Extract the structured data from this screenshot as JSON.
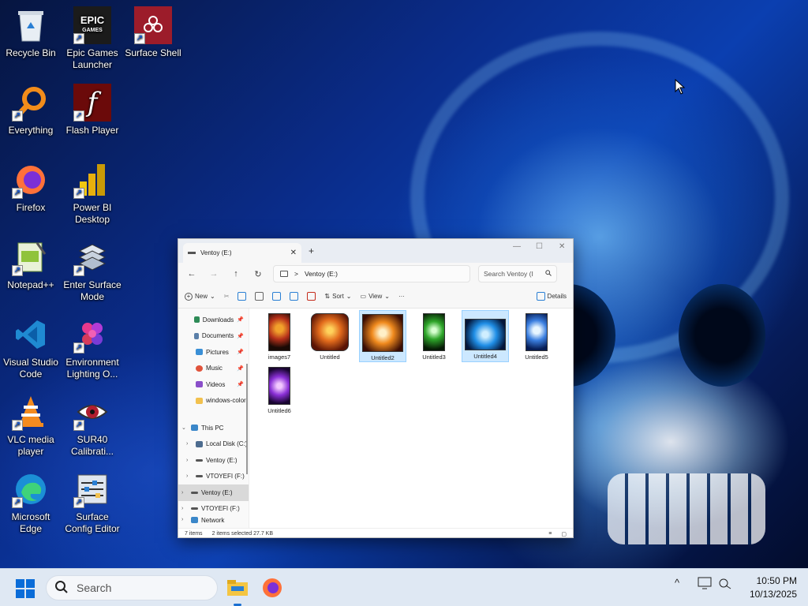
{
  "desktop": {
    "icons": [
      {
        "label": "Recycle Bin",
        "icon": "recycle-bin-icon"
      },
      {
        "label": "Epic Games Launcher",
        "icon": "epic-games-icon"
      },
      {
        "label": "Surface Shell",
        "icon": "surface-shell-icon"
      },
      {
        "label": "Everything",
        "icon": "everything-search-icon"
      },
      {
        "label": "Flash Player",
        "icon": "flash-player-icon"
      },
      {
        "label": "Firefox",
        "icon": "firefox-icon"
      },
      {
        "label": "Power BI Desktop",
        "icon": "power-bi-icon"
      },
      {
        "label": "Notepad++",
        "icon": "notepad-plus-plus-icon"
      },
      {
        "label": "Enter Surface Mode",
        "icon": "surface-mode-icon"
      },
      {
        "label": "Visual Studio Code",
        "icon": "vscode-icon"
      },
      {
        "label": "Environment Lighting O...",
        "icon": "environment-lighting-icon"
      },
      {
        "label": "VLC media player",
        "icon": "vlc-icon"
      },
      {
        "label": "SUR40 Calibrati...",
        "icon": "sur40-calibration-icon"
      },
      {
        "label": "Microsoft Edge",
        "icon": "edge-icon"
      },
      {
        "label": "Surface Config Editor",
        "icon": "surface-config-editor-icon"
      }
    ]
  },
  "explorer": {
    "tab_title": "Ventoy (E:)",
    "tab_close": "✕",
    "new_tab": "+",
    "window_controls": {
      "minimize": "—",
      "maximize": "☐",
      "close": "✕"
    },
    "nav": {
      "back": "←",
      "forward": "→",
      "up": "↑",
      "refresh": "↻"
    },
    "address": {
      "separator": ">",
      "path": "Ventoy (E:)"
    },
    "search_placeholder": "Search Ventoy (I",
    "toolbar": {
      "new": "New",
      "sort": "Sort",
      "view": "View",
      "more": "···",
      "details": "Details"
    },
    "navpane": [
      {
        "label": "Downloads",
        "pinned": true,
        "color": "#2e8b57",
        "chev": ""
      },
      {
        "label": "Documents",
        "pinned": true,
        "color": "#5a7fa8",
        "chev": ""
      },
      {
        "label": "Pictures",
        "pinned": true,
        "color": "#3a8fd6",
        "chev": ""
      },
      {
        "label": "Music",
        "pinned": true,
        "color": "#e0533b",
        "chev": ""
      },
      {
        "label": "Videos",
        "pinned": true,
        "color": "#8a4fc9",
        "chev": ""
      },
      {
        "label": "windows-color-",
        "pinned": false,
        "color": "#f2c14e",
        "chev": ""
      },
      {
        "label": "",
        "pinned": false,
        "color": "",
        "chev": ""
      },
      {
        "label": "This PC",
        "pinned": false,
        "color": "#3b87c9",
        "chev": "⌄"
      },
      {
        "label": "Local Disk (C:)",
        "pinned": false,
        "color": "#4d6c8f",
        "chev": "›"
      },
      {
        "label": "Ventoy (E:)",
        "pinned": false,
        "color": "#555555",
        "chev": "›"
      },
      {
        "label": "VTOYEFI (F:)",
        "pinned": false,
        "color": "#555555",
        "chev": "›"
      },
      {
        "label": "Ventoy (E:)",
        "pinned": false,
        "color": "#555555",
        "chev": "›",
        "selected": true
      },
      {
        "label": "VTOYEFI (F:)",
        "pinned": false,
        "color": "#555555",
        "chev": "›"
      },
      {
        "label": "Network",
        "pinned": false,
        "color": "#3b87c9",
        "chev": "›"
      }
    ],
    "files": [
      {
        "name": "images7",
        "selected": false
      },
      {
        "name": "Untitled",
        "selected": false
      },
      {
        "name": "Untitled2",
        "selected": true
      },
      {
        "name": "Untitled3",
        "selected": false
      },
      {
        "name": "Untitled4",
        "selected": true
      },
      {
        "name": "Untitled5",
        "selected": false
      },
      {
        "name": "Untitled6",
        "selected": false
      }
    ],
    "status": {
      "count": "7 items",
      "selection": "2 items selected  27.7 KB"
    }
  },
  "taskbar": {
    "search_label": "Search",
    "tray_chevron": "^",
    "time": "10:50 PM",
    "date": "10/13/2025"
  }
}
